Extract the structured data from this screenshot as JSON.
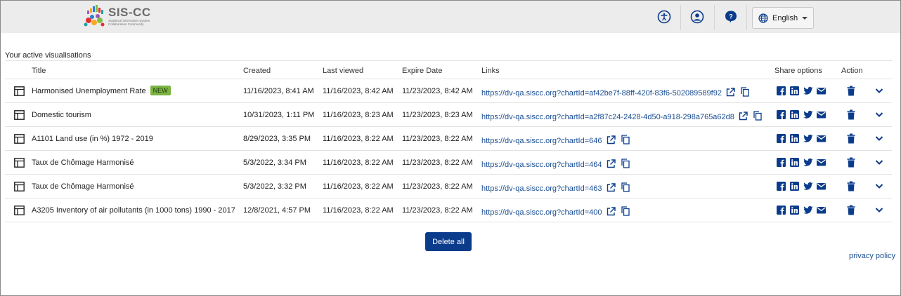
{
  "brand": {
    "name": "SIS-CC",
    "subtitle": "Statistical Information System Collaboration Community"
  },
  "header": {
    "language_label": "English",
    "icons": [
      "accessibility-icon",
      "user-account-icon",
      "help-icon",
      "globe-icon"
    ]
  },
  "section_title": "Your active visualisations",
  "columns": {
    "title": "Title",
    "created": "Created",
    "last_viewed": "Last viewed",
    "expire_date": "Expire Date",
    "links": "Links",
    "share_options": "Share options",
    "action": "Action"
  },
  "rows": [
    {
      "title": "Harmonised Unemployment Rate",
      "badge": "NEW",
      "created": "11/16/2023, 8:41 AM",
      "last_viewed": "11/16/2023, 8:42 AM",
      "expire": "11/23/2023, 8:42 AM",
      "link": "https://dv-qa.siscc.org?chartId=af42be7f-88ff-420f-83f6-502089589f92"
    },
    {
      "title": "Domestic tourism",
      "badge": "",
      "created": "10/31/2023, 1:11 PM",
      "last_viewed": "11/16/2023, 8:23 AM",
      "expire": "11/23/2023, 8:23 AM",
      "link": "https://dv-qa.siscc.org?chartId=a2f87c24-2428-4d50-a918-298a765a62d8"
    },
    {
      "title": "A1101 Land use (in %) 1972 - 2019",
      "badge": "",
      "created": "8/29/2023, 3:35 PM",
      "last_viewed": "11/16/2023, 8:22 AM",
      "expire": "11/23/2023, 8:22 AM",
      "link": "https://dv-qa.siscc.org?chartId=646"
    },
    {
      "title": "Taux de Chômage Harmonisé",
      "badge": "",
      "created": "5/3/2022, 3:34 PM",
      "last_viewed": "11/16/2023, 8:22 AM",
      "expire": "11/23/2023, 8:22 AM",
      "link": "https://dv-qa.siscc.org?chartId=464"
    },
    {
      "title": "Taux de Chômage Harmonisé",
      "badge": "",
      "created": "5/3/2022, 3:32 PM",
      "last_viewed": "11/16/2023, 8:22 AM",
      "expire": "11/23/2023, 8:22 AM",
      "link": "https://dv-qa.siscc.org?chartId=463"
    },
    {
      "title": "A3205 Inventory of air pollutants (in 1000 tons) 1990 - 2017",
      "badge": "",
      "created": "12/8/2021, 4:57 PM",
      "last_viewed": "11/16/2023, 8:22 AM",
      "expire": "11/23/2023, 8:22 AM",
      "link": "https://dv-qa.siscc.org?chartId=400"
    }
  ],
  "delete_all_label": "Delete all",
  "privacy_label": "privacy policy",
  "colors": {
    "accent": "#0b3c8c",
    "link": "#1a4e94",
    "badge": "#7cb342",
    "header_bg": "#ececec"
  }
}
